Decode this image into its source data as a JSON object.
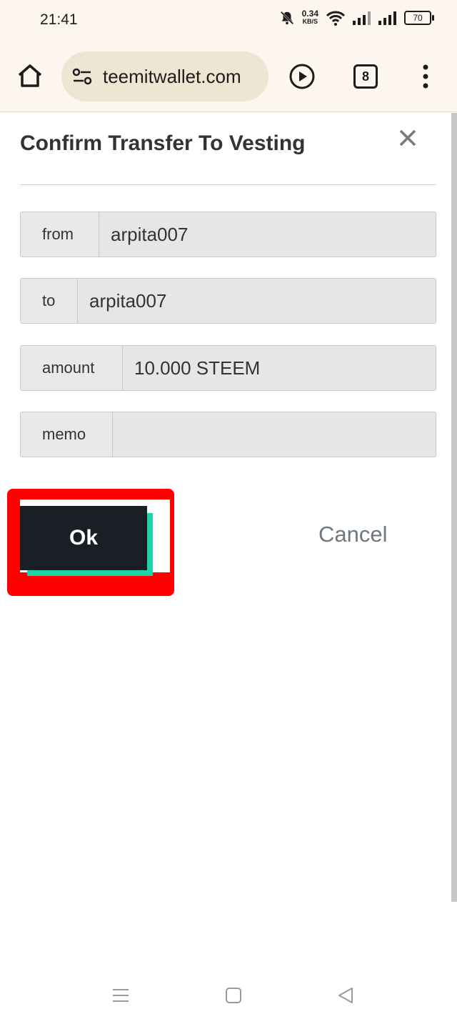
{
  "status_bar": {
    "time": "21:41",
    "net_speed_value": "0.34",
    "net_speed_unit": "KB/S",
    "battery": "70"
  },
  "browser": {
    "url": "teemitwallet.com",
    "tab_count": "8"
  },
  "dialog": {
    "title": "Confirm Transfer To Vesting",
    "fields": [
      {
        "label": "from",
        "value": "arpita007"
      },
      {
        "label": "to",
        "value": "arpita007"
      },
      {
        "label": "amount",
        "value": "10.000 STEEM"
      },
      {
        "label": "memo",
        "value": ""
      }
    ],
    "ok_label": "Ok",
    "cancel_label": "Cancel"
  },
  "colors": {
    "accent": "#1fd1a8",
    "highlight": "#ff0000",
    "button_dark": "#1a1f26"
  }
}
